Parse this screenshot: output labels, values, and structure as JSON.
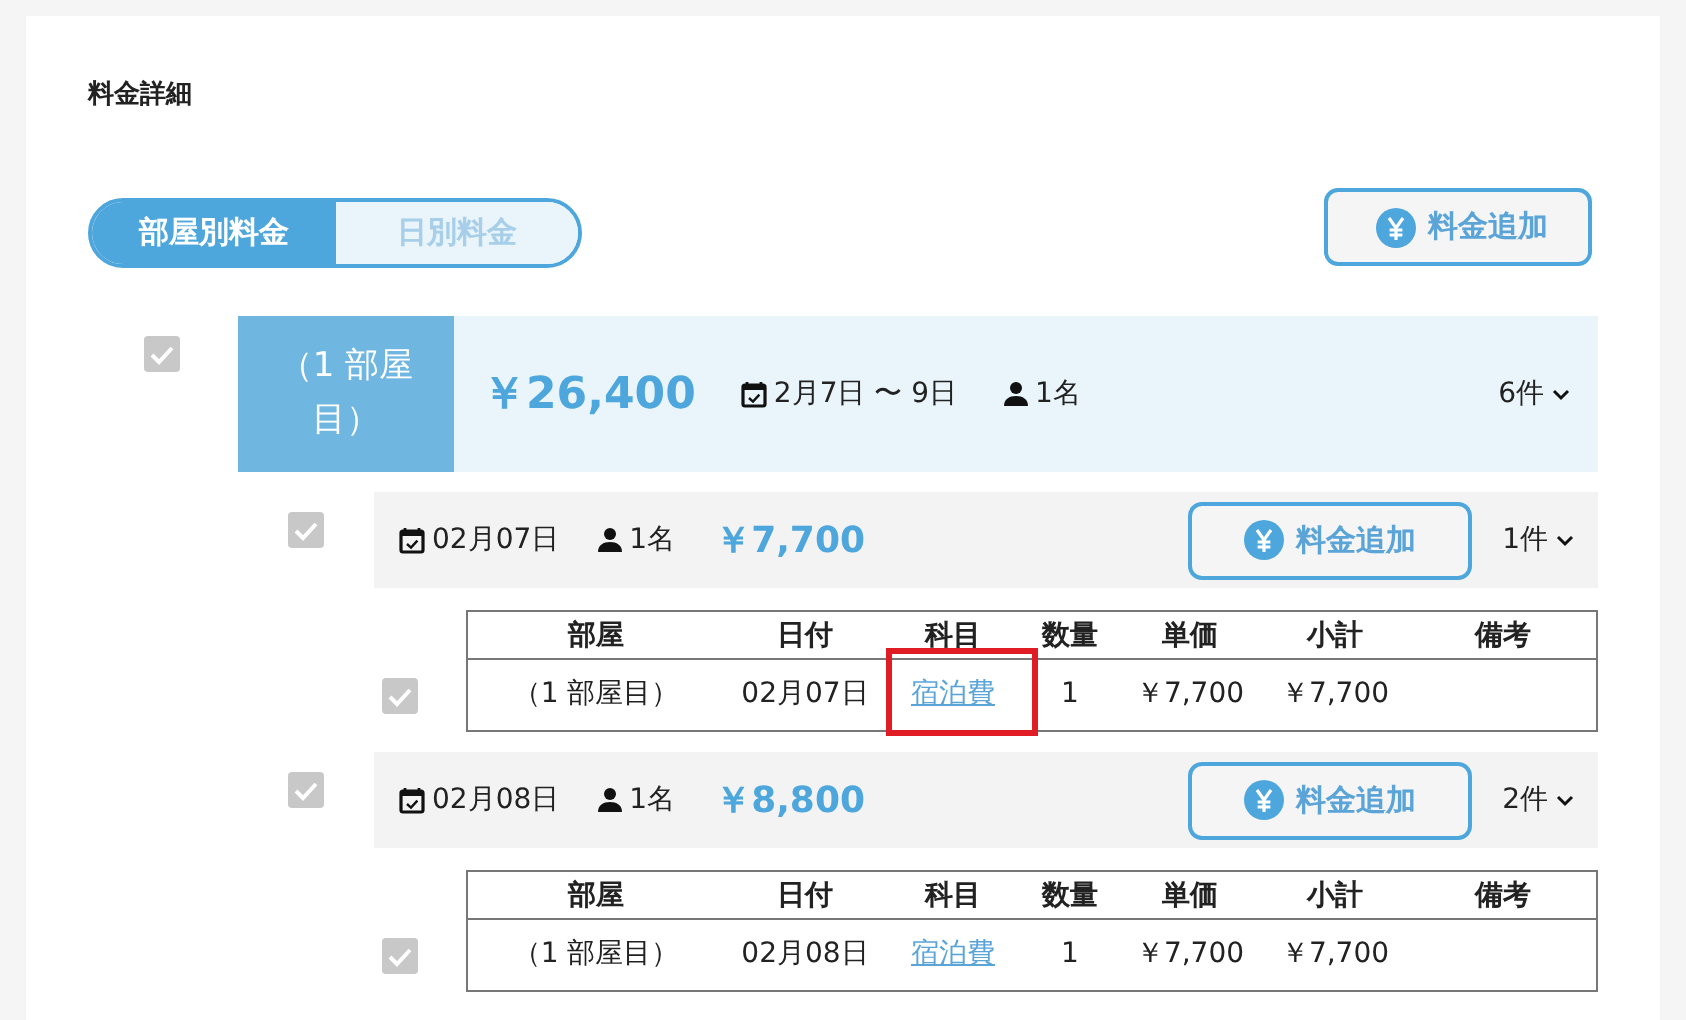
{
  "section_title": "料金詳細",
  "view_tabs": [
    {
      "label": "部屋別料金",
      "selected": true
    },
    {
      "label": "日別料金",
      "selected": false
    }
  ],
  "add_button": {
    "label": "料金追加"
  },
  "room_group": {
    "checked": true,
    "room_label": "（1 部屋目）",
    "total": "￥26,400",
    "date_range": "2月7日 〜 9日",
    "guests": "1名",
    "count": "6件",
    "expanded": true,
    "days": [
      {
        "checked": true,
        "date": "02月07日",
        "guests": "1名",
        "total": "￥7,700",
        "button": "料金追加",
        "count": "1件",
        "expanded": true,
        "columns": [
          "部屋",
          "日付",
          "科目",
          "数量",
          "単価",
          "小計",
          "備考"
        ],
        "rows": [
          {
            "checked": true,
            "room": "（1 部屋目）",
            "date": "02月07日",
            "item": "宿泊費",
            "quantity": "1",
            "unit_price": "￥7,700",
            "subtotal": "￥7,700",
            "highlighted": true
          }
        ]
      },
      {
        "checked": true,
        "date": "02月08日",
        "guests": "1名",
        "total": "￥8,800",
        "button": "料金追加",
        "count": "2件",
        "expanded": true,
        "columns": [
          "部屋",
          "日付",
          "科目",
          "数量",
          "単価",
          "小計",
          "備考"
        ],
        "rows": [
          {
            "checked": true,
            "room": "（1 部屋目）",
            "date": "02月08日",
            "item": "宿泊費",
            "quantity": "1",
            "unit_price": "￥7,700",
            "subtotal": "￥7,700",
            "highlighted": false
          }
        ]
      }
    ]
  }
}
